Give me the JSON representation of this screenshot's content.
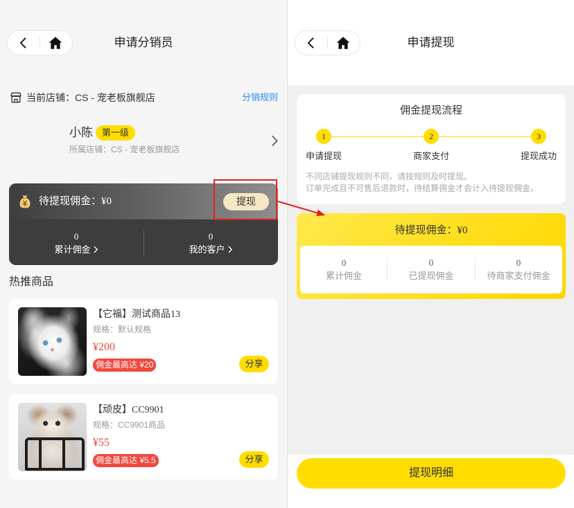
{
  "colors": {
    "accent_yellow": "#ffdd00",
    "price_red": "#e8473b",
    "commission_pill_red": "#f0483e",
    "link_blue": "#2b8cf2",
    "withdraw_button_beige": "#f6e7c4",
    "annotation_red": "#e3201c",
    "dark_card": "#3d3d3d"
  },
  "icons": {
    "nav_back": "back-icon",
    "nav_home": "home-icon",
    "store": "store-icon",
    "user_arrow": "chevron-right-icon",
    "commission": "money-bag-icon",
    "stat_arrow": "chevron-right-icon"
  },
  "distributor_page": {
    "nav": {
      "title": "申请分销员"
    },
    "store_bar": {
      "label": "当前店铺：CS - 宠老板旗舰店",
      "rules_link": "分销规则"
    },
    "user": {
      "name": "小陈",
      "level_badge": "第一级",
      "store": "所属店铺：CS - 宠老板旗舰店"
    },
    "commission_card": {
      "pending_label": "待提现佣金：¥0",
      "withdraw_button": "提现",
      "stats": [
        {
          "value": "0",
          "label": "累计佣金"
        },
        {
          "value": "0",
          "label": "我的客户"
        }
      ]
    },
    "hot_section_title": "热推商品",
    "products": [
      {
        "name": "【它福】测试商品13",
        "spec": "规格：默认规格",
        "price": "¥200",
        "commission": "佣金最高达 ¥20",
        "share_button": "分享"
      },
      {
        "name": "【顽皮】CC9901",
        "spec": "规格：CC9901商品",
        "price": "¥55",
        "commission": "佣金最高达 ¥5.5",
        "share_button": "分享"
      }
    ]
  },
  "withdraw_page": {
    "nav": {
      "title": "申请提现"
    },
    "process": {
      "title": "佣金提现流程",
      "steps": [
        {
          "number": "1",
          "label": "申请提现"
        },
        {
          "number": "2",
          "label": "商家支付"
        },
        {
          "number": "3",
          "label": "提现成功"
        }
      ],
      "notes": [
        "不同店铺提现规则不同，请按规则及时提现。",
        "订单完成且不可售后退款时，待结算佣金才会计入待提现佣金。"
      ]
    },
    "balance_card": {
      "title": "待提现佣金：¥0",
      "stats": [
        {
          "value": "0",
          "label": "累计佣金"
        },
        {
          "value": "0",
          "label": "已提现佣金"
        },
        {
          "value": "0",
          "label": "待商家支付佣金"
        }
      ]
    },
    "detail_button": "提现明细"
  }
}
